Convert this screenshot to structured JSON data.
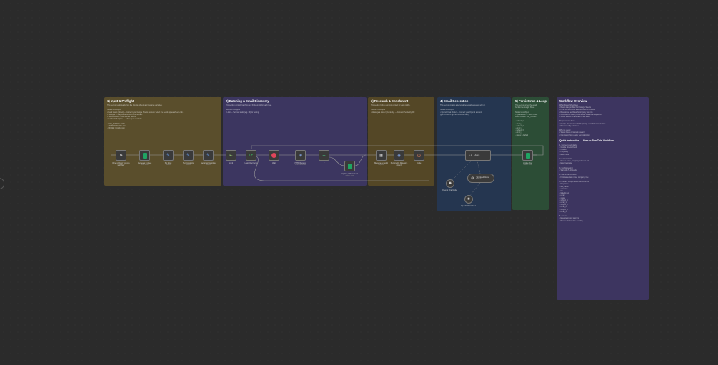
{
  "panels": {
    "input": {
      "title": "1) Input & Preflight",
      "lines": [
        "This section reads leads from the Google Sheets and prepares variables.",
        "",
        "Nodes to configure",
        "• Read Leads (Sheet) — Connect your Google Sheets account. Select the Leads Spreadsheet + tab.",
        "• Set Input — map the fields used downstream",
        "• Set Constants — Add sender details",
        "• Set Email Template — edit subject and body",
        "",
        "  ◦ MAX_TOKENS = 500",
        "  ◦ TEMPERATURE = 0.7",
        "  ◦ MODEL = gpt-4o-mini"
      ]
    },
    "batch": {
      "title": "2) Batching & Email Discovery",
      "lines": [
        "This section controls batching and finds emails for each lead.",
        "",
        "Nodes to configure",
        "• Limit — Set max leads (e.g. 10) for testing"
      ]
    },
    "research": {
      "title": "3) Research & Enrichment",
      "lines": [
        "This section builds a prompt context for each profile.",
        "",
        "Nodes to configure",
        "• Message a model (Perplexity) — Connect Perplexity API"
      ]
    },
    "email": {
      "title": "4) Email Generation",
      "lines": [
        "This section creates a personalized email sequence with AI.",
        "",
        "Nodes to configure",
        "• OpenAI Chat Model — Connect your OpenAI account.",
        "  (gpt-4o-mini or gpt-4o recommended)"
      ]
    },
    "persist": {
      "title": "5) Persistence & Loop",
      "lines": [
        "This section writes the email",
        "back to the Google Sheet.",
        "",
        "Nodes to configure",
        "• Update Row — Same sheet",
        "  Match column: row_number",
        "",
        "  ◦ subject_1",
        "  ◦ email_1",
        "  ◦ subject_2",
        "  ◦ email_2",
        "  ◦ subject_3",
        "  ◦ email_3",
        "  ◦ status = drafted"
      ]
    },
    "overview": {
      "title": "Workflow Overview",
      "lines": [
        "What this workflow does",
        "• Reads lead profiles from Google Sheets",
        "• Finds verified email addresses via enrichment",
        "• Researches each lead's company and role",
        "• Generates a 3-step personalized cold email sequence",
        "• Writes drafted emails back to the sheet",
        "",
        "Requirements & use",
        "• Google Sheets, OpenAI, Perplexity, email finder credentials",
        "• Run manually in batches",
        "",
        "Why it's useful",
        "• Saves hours of manual research",
        "• Consistent, high quality personalization"
      ],
      "quick_title": "Quick Instruction — How to Run This Workflow",
      "quick_lines": [
        "1. Connect credentials",
        "   ◦ Google Sheets OAuth",
        "   ◦ OpenAI",
        "   ◦ Perplexity",
        "   ◦ Email finder",
        "",
        "2. Set constants",
        "   ◦ Sender name, company, calendar link",
        "   ◦ Email template",
        "",
        "3. Configure Limit",
        "   ◦ Start with 5–10 leads",
        "",
        "4. Map sheet columns",
        "   ◦ First name, last name, company, title",
        "",
        "5. Prepare Google Sheet with columns",
        "   ◦ first_name",
        "   ◦ last_name",
        "   ◦ company",
        "   ◦ title",
        "   ◦ linkedin_url",
        "   ◦ email",
        "   ◦ status",
        "   ◦ subject_1",
        "   ◦ email_1",
        "   ◦ subject_2",
        "   ◦ email_2",
        "   ◦ subject_3",
        "   ◦ email_3",
        "",
        "6. Test run",
        "   ◦ Execute on one lead first",
        "   ◦ Review drafts before sending"
      ]
    }
  },
  "nodes": {
    "manual": {
      "label": "When clicking 'Execute workflow'",
      "sub": ""
    },
    "read": {
      "label": "Get leads in sheet",
      "sub": "read: sheet"
    },
    "setinput": {
      "label": "Set Input",
      "sub": "manual"
    },
    "constants": {
      "label": "Set Constants",
      "sub": "manual"
    },
    "template": {
      "label": "Set Email Template",
      "sub": "manual"
    },
    "limit": {
      "label": "Limit",
      "sub": ""
    },
    "loop": {
      "label": "Loop Over Items",
      "sub": ""
    },
    "wait": {
      "label": "Wait",
      "sub": ""
    },
    "http": {
      "label": "HTTP Request",
      "sub": "POST: find email"
    },
    "if": {
      "label": "If",
      "sub": ""
    },
    "update_found": {
      "label": "Update in Row found",
      "sub": "update: sheet"
    },
    "message": {
      "label": "Message a model",
      "sub": "Perplexity"
    },
    "research_agent": {
      "label": "Personalize Research (Agent)",
      "sub": ""
    },
    "code": {
      "label": "Code",
      "sub": ""
    },
    "agent": {
      "label": "Agent",
      "sub": ""
    },
    "chat_model": {
      "label": "OpenAI Chat Model",
      "sub": ""
    },
    "parser": {
      "label": "Structured Output Parser",
      "sub": ""
    },
    "chat_model_2": {
      "label": "OpenAI Chat Model",
      "sub": ""
    },
    "update_row": {
      "label": "Update Row",
      "sub": "update: sheet"
    }
  },
  "colors": {
    "input": "#5a4e2c",
    "batch": "#3c3660",
    "research": "#544726",
    "email": "#253650",
    "persist": "#2c4d36",
    "overview": "#3d3560",
    "sheets": "#1fa463",
    "wait": "#e0455a",
    "loop": "#3aa55d"
  },
  "icons": {
    "manual": "cursor-icon",
    "sheets": "spreadsheet-icon",
    "set": "pencil-icon",
    "limit": "limit-icon",
    "loop": "loop-icon",
    "wait": "stop-icon",
    "http": "globe-icon",
    "if": "branch-icon",
    "message": "chat-icon",
    "agent": "robot-icon",
    "code": "braces-icon",
    "model": "openai-icon",
    "parser": "parser-icon"
  }
}
